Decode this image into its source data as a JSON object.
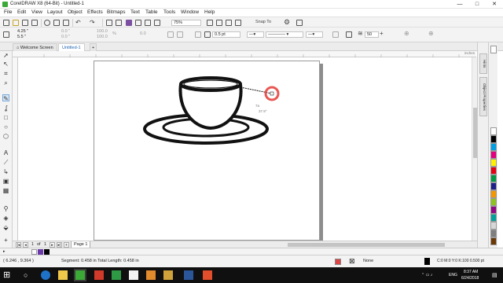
{
  "window": {
    "title": "CorelDRAW X8 (64-Bit) - Untitled-1",
    "controls": [
      "—",
      "□",
      "✕"
    ]
  },
  "menu": [
    "File",
    "Edit",
    "View",
    "Layout",
    "Object",
    "Effects",
    "Bitmaps",
    "Text",
    "Table",
    "Tools",
    "Window",
    "Help"
  ],
  "toolbar": {
    "zoom": "75%",
    "snap_to": "Snap To",
    "x_pos": "4.25 \"",
    "y_pos": "5.5 \"",
    "width_val": "0.0 \"",
    "height_val": "0.0 \"",
    "scale_w": "100.0",
    "scale_h": "100.0",
    "unit": "%",
    "rotation": "0.0",
    "outline_width": "0.5 pt",
    "smoothing": "50"
  },
  "tabs": {
    "welcome": "Welcome Screen",
    "document": "Untitled-1",
    "add": "+"
  },
  "ruler": {
    "unit": "inches"
  },
  "pages": {
    "current": "1",
    "of_label": "of",
    "total": "1",
    "page_tab": "Page 1"
  },
  "dockers": {
    "tab1": "Hints",
    "tab2": "Object Properties"
  },
  "canvas": {
    "tooltip_lines": [
      "7a",
      "37.9°"
    ],
    "node_label": "N"
  },
  "status": {
    "cursor": "( 6.246 , 9.364 )",
    "segment": "Segment: 0.458 in Total Length: 0.458 in",
    "fill": "None",
    "outline": "C:0 M:0 Y:0 K:100  0.500 pt"
  },
  "taskbar": {
    "lang": "ENG",
    "time": "8:37 AM",
    "date": "6/24/2018"
  },
  "colors": {
    "accent": "#1f64b4",
    "corel_green": "#3aa935",
    "cursor_ring": "#e53935",
    "palette": [
      "#ffffff",
      "#000000",
      "#00a0e3",
      "#e4007f",
      "#fff100",
      "#e60012",
      "#009944",
      "#1d2088",
      "#f39800",
      "#8fc31f",
      "#920783",
      "#00a29a",
      "#d7d7d7",
      "#7f7f7f",
      "#c30d23",
      "#6a3906"
    ]
  },
  "icons": {
    "pick_tool": "arrow-icon",
    "freehand_tool": "pen-icon",
    "snap": "magnet-icon"
  }
}
